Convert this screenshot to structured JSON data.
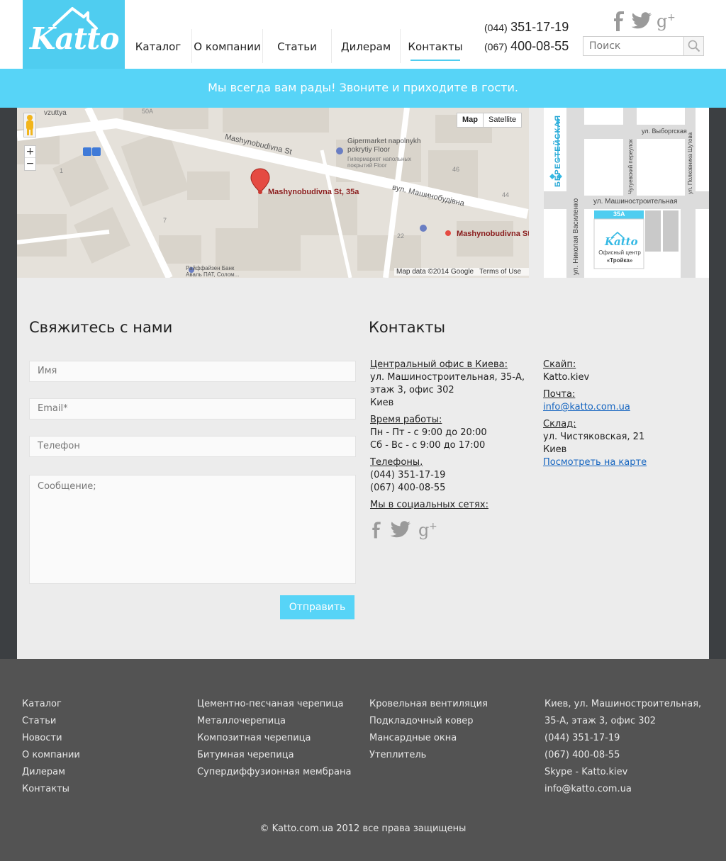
{
  "logo": {
    "text": "Katto"
  },
  "nav": {
    "items": [
      {
        "label": "Каталог"
      },
      {
        "label": "О компании"
      },
      {
        "label": "Статьи"
      },
      {
        "label": "Дилерам"
      },
      {
        "label": "Контакты",
        "active": true
      }
    ]
  },
  "header": {
    "phones": [
      {
        "code": "(044)",
        "number": "351-17-19"
      },
      {
        "code": "(067)",
        "number": "400-08-55"
      }
    ],
    "search_placeholder": "Поиск"
  },
  "banner": {
    "text": "Мы всегда вам рады! Звоните и приходите в гости."
  },
  "map": {
    "toggle": {
      "map": "Map",
      "satellite": "Satellite"
    },
    "pin_label": "Mashynobudivna St, 35a",
    "pin2_label": "Mashynobudivna St",
    "street_en": "Mashynobudivna St",
    "street_ua": "вул. Машинобудівна",
    "store_en": "Gipermarket napolnykh pokrytiy Floor",
    "store_ru": "Гипермаркет напольных покрытий Floor",
    "bank": "Райффайзен Банк Аваль ПАТ, Солом...",
    "top_left": "vzuttya",
    "num_50a": "50A",
    "num_46": "46",
    "num_44": "44",
    "num_22": "22",
    "num_7": "7",
    "num_1": "1",
    "attribution": "Map data ©2014 Google",
    "terms": "Terms of Use",
    "zoom_in": "+",
    "zoom_out": "−"
  },
  "scheme": {
    "metro": "БЕРЕСТЕЙСКАЯ",
    "street_vyborg": "ул. Выборгская",
    "street_chuguev": "Чугуевский переулок",
    "street_polkovnika": "ул. Полковника Шутова",
    "street_mashin": "ул. Машиностроительная",
    "street_nikolaya": "ул. Николая Василенко",
    "building_no": "35А",
    "logo": "Katto",
    "office_line1": "Офисный центр",
    "office_line2": "«Тройка»"
  },
  "contact_form": {
    "title": "Свяжитесь с нами",
    "name": "Имя",
    "email": "Email*",
    "phone": "Телефон",
    "message": "Сообщение;",
    "submit": "Отправить"
  },
  "contacts": {
    "title": "Контакты",
    "office_label": "Центральный офис в Киева:",
    "office_line1": "ул. Машиностроительная, 35-А,",
    "office_line2": "этаж 3, офис 302",
    "office_city": "Киев",
    "hours_label": "Время работы:",
    "hours_line1": "Пн - Пт - с 9:00 до 20:00",
    "hours_line2": "Сб - Вс - с 9:00 до 17:00",
    "phones_label": "Телефоны,",
    "phone1": "(044) 351-17-19",
    "phone2": "(067) 400-08-55",
    "social_label": "Мы в социальных сетях:",
    "skype_label": "Скайп:",
    "skype": "Katto.kiev",
    "mail_label": "Почта:",
    "mail": "info@katto.com.ua",
    "warehouse_label": "Склад:",
    "warehouse_line1": "ул. Чистяковская, 21",
    "warehouse_city": "Киев",
    "map_link": "Посмотреть на карте"
  },
  "footer": {
    "col1": [
      "Каталог",
      "Статьи",
      "Новости",
      "О компании",
      "Дилерам",
      "Контакты"
    ],
    "col2": [
      "Цементно-песчаная черепица",
      "Металлочерепица",
      "Композитная черепица",
      "Битумная черепица",
      "Супердиффузионная мембрана"
    ],
    "col3": [
      "Кровельная вентиляция",
      "Подкладочный ковер",
      "Мансардные окна",
      "Утеплитель"
    ],
    "col4": [
      "Киев, ул. Машиностроительная,",
      "35-А, этаж 3, офис 302",
      "(044) 351-17-19",
      "(067) 400-08-55",
      "Skype - Katto.kiev",
      "info@katto.com.ua"
    ],
    "copyright": "© Katto.com.ua 2012 все права защищены"
  },
  "colors": {
    "accent": "#57d4f7",
    "footer_bg": "#535353",
    "page_bg": "#3c3f42",
    "content_bg": "#ececec"
  }
}
